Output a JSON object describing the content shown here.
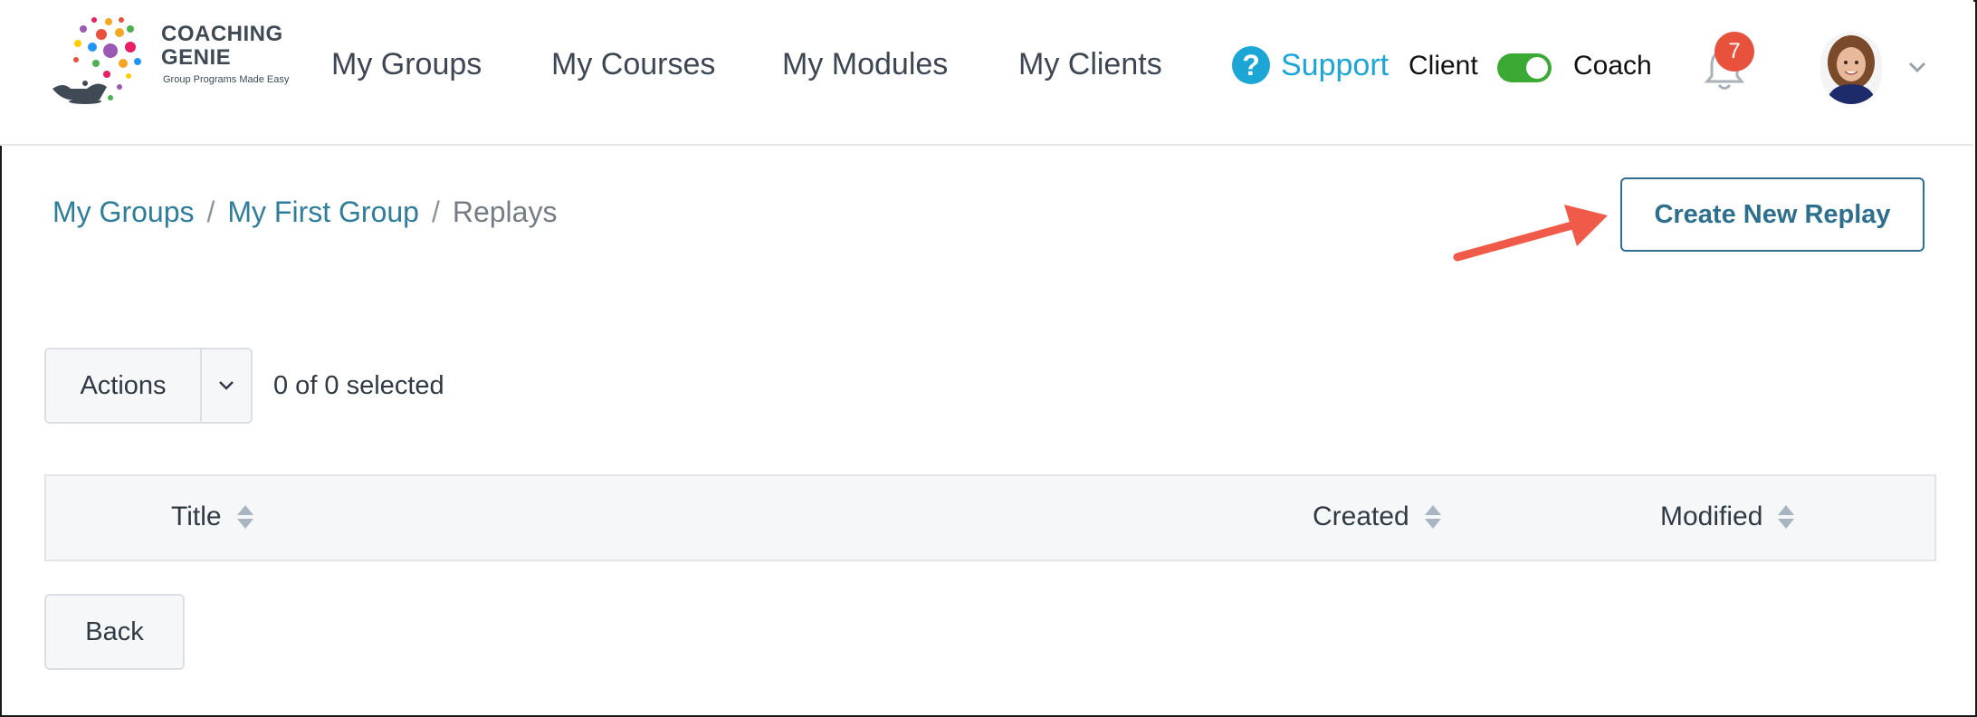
{
  "brand": {
    "name_line1": "COACHING",
    "name_line2": "GENIE",
    "tagline": "Group Programs Made Easy",
    "logo_dot_colors": [
      "#e8513b",
      "#f5a623",
      "#9b59b6",
      "#e91e63",
      "#4caf50",
      "#2196f3",
      "#ffcc00"
    ]
  },
  "nav": {
    "items": [
      {
        "label": "My Groups"
      },
      {
        "label": "My Courses"
      },
      {
        "label": "My Modules"
      },
      {
        "label": "My Clients"
      }
    ],
    "support_label": "Support",
    "support_icon": "question-circle-icon",
    "role_left": "Client",
    "role_right": "Coach",
    "role_toggle_on": true,
    "notification_count": "7"
  },
  "breadcrumb": {
    "items": [
      {
        "label": "My Groups"
      },
      {
        "label": "My First Group"
      }
    ],
    "current": "Replays",
    "separator": "/"
  },
  "toolbar": {
    "create_label": "Create New Replay",
    "actions_label": "Actions",
    "selection_status": "0 of 0 selected"
  },
  "table": {
    "columns": [
      {
        "label": "Title"
      },
      {
        "label": "Created"
      },
      {
        "label": "Modified"
      }
    ],
    "rows": []
  },
  "footer": {
    "back_label": "Back"
  },
  "colors": {
    "accent": "#2e6f8e",
    "link": "#2e7d9b",
    "support": "#1ba6d6",
    "toggle_on": "#3aaa35",
    "badge": "#e8513b",
    "annotation_arrow": "#f05a48"
  }
}
